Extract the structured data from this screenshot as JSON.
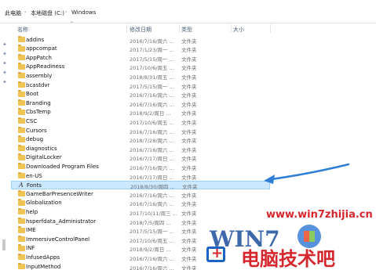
{
  "breadcrumb": {
    "items": [
      "此电脑",
      "本地磁盘 (C:)",
      "Windows"
    ],
    "separator": "›"
  },
  "columns": {
    "name": "名称",
    "modified": "修改日期",
    "type": "类型",
    "size": "大小"
  },
  "rows": [
    {
      "name": "addins",
      "date": "2016/7/16/周六 ...",
      "type": "文件夹",
      "icon": "folder-icon"
    },
    {
      "name": "appcompat",
      "date": "2017/1/23/周一 ...",
      "type": "文件夹",
      "icon": "folder-icon"
    },
    {
      "name": "AppPatch",
      "date": "2017/5/15/周一 ...",
      "type": "文件夹",
      "icon": "folder-icon"
    },
    {
      "name": "AppReadiness",
      "date": "2017/10/6/周五 ...",
      "type": "文件夹",
      "icon": "folder-icon"
    },
    {
      "name": "assembly",
      "date": "2018/8/31/周五 ...",
      "type": "文件夹",
      "icon": "folder-icon"
    },
    {
      "name": "bcastdvr",
      "date": "2017/5/15/周一 ...",
      "type": "文件夹",
      "icon": "folder-icon"
    },
    {
      "name": "Boot",
      "date": "2016/7/16/周六 ...",
      "type": "文件夹",
      "icon": "folder-icon"
    },
    {
      "name": "Branding",
      "date": "2016/7/16/周六 ...",
      "type": "文件夹",
      "icon": "folder-icon"
    },
    {
      "name": "CbsTemp",
      "date": "2018/9/2/周日 ...",
      "type": "文件夹",
      "icon": "folder-icon"
    },
    {
      "name": "CSC",
      "date": "2017/10/6/周五 ...",
      "type": "文件夹",
      "icon": "folder-icon"
    },
    {
      "name": "Cursors",
      "date": "2016/7/16/周六 ...",
      "type": "文件夹",
      "icon": "folder-icon"
    },
    {
      "name": "debug",
      "date": "2018/7/28/周六 ...",
      "type": "文件夹",
      "icon": "folder-icon"
    },
    {
      "name": "diagnostics",
      "date": "2016/7/16/周六 ...",
      "type": "文件夹",
      "icon": "folder-icon"
    },
    {
      "name": "DigitalLocker",
      "date": "2016/7/17/周日 ...",
      "type": "文件夹",
      "icon": "folder-icon"
    },
    {
      "name": "Downloaded Program Files",
      "date": "2016/7/16/周六 ...",
      "type": "文件夹",
      "icon": "folder-icon"
    },
    {
      "name": "en-US",
      "date": "2016/7/17/周日 ...",
      "type": "文件夹",
      "icon": "folder-icon"
    },
    {
      "name": "Fonts",
      "date": "2018/8/30/周四 ...",
      "type": "文件夹",
      "icon": "font-icon",
      "selected": true
    },
    {
      "name": "GameBarPresenceWriter",
      "date": "2016/7/16/周六 ...",
      "type": "文件夹",
      "icon": "folder-icon"
    },
    {
      "name": "Globalization",
      "date": "2016/7/16/周六 ...",
      "type": "文件夹",
      "icon": "folder-icon"
    },
    {
      "name": "help",
      "date": "2017/10/11/周三 ...",
      "type": "文件夹",
      "icon": "folder-icon"
    },
    {
      "name": "hsperfdata_Administrator",
      "date": "2018/7/5/周四 ...",
      "type": "文件夹",
      "icon": "folder-icon"
    },
    {
      "name": "IME",
      "date": "2017/5/15/周一 ...",
      "type": "文件夹",
      "icon": "folder-icon"
    },
    {
      "name": "ImmersiveControlPanel",
      "date": "2017/10/6/周五 ...",
      "type": "文件夹",
      "icon": "folder-icon"
    },
    {
      "name": "INF",
      "date": "2018/9/2/周日 ...",
      "type": "文件夹",
      "icon": "folder-icon"
    },
    {
      "name": "InfusedApps",
      "date": "2016/7/16/周六 ...",
      "type": "文件夹",
      "icon": "folder-icon"
    },
    {
      "name": "InputMethod",
      "date": "2016/7/16/周六 ...",
      "type": "文件夹",
      "icon": "folder-icon"
    }
  ],
  "watermark": {
    "url": "www.win7zhijia.cn",
    "logo_text": "WIN7",
    "cn_text": "电脑技术吧"
  },
  "colors": {
    "selection": "#cce8ff",
    "folder": "#f0c454",
    "arrow": "#2f7fd6",
    "watermark_red": "#d6262d"
  }
}
